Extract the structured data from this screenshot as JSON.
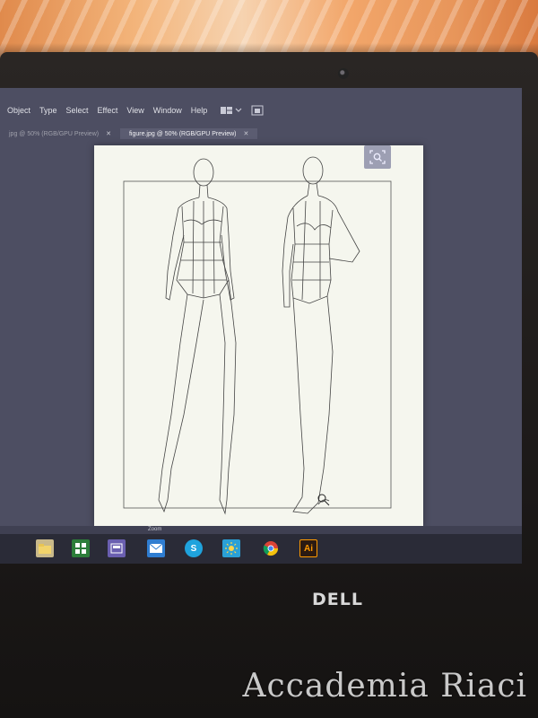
{
  "menu": {
    "items": [
      "Object",
      "Type",
      "Select",
      "Effect",
      "View",
      "Window",
      "Help"
    ]
  },
  "tabs": [
    {
      "label": "jpg @ 50% (RGB/GPU Preview)",
      "active": false
    },
    {
      "label": "figure.jpg @ 50% (RGB/GPU Preview)",
      "active": true
    }
  ],
  "status": {
    "zoom_label": "Zoom"
  },
  "taskbar": {
    "icons": [
      "file-explorer-icon",
      "store-icon",
      "app-tile-icon",
      "mail-icon",
      "skype-icon",
      "weather-icon",
      "chrome-icon",
      "illustrator-icon"
    ],
    "skype_glyph": "S",
    "ai_glyph": "Ai"
  },
  "brand": {
    "laptop": "DELL"
  },
  "watermark": {
    "text": "Accademia Riaci"
  },
  "colors": {
    "screen_bg": "#4d4e62",
    "document_bg": "#f5f6ee",
    "illustrator_accent": "#ff9a00"
  }
}
